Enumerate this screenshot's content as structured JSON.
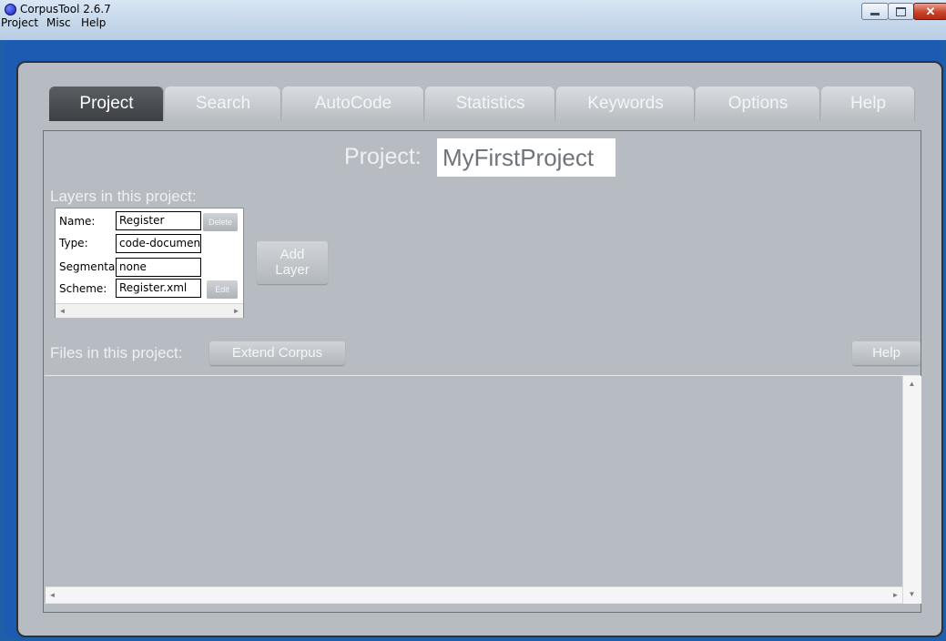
{
  "window": {
    "title": "CorpusTool 2.6.7",
    "close_glyph": "✕"
  },
  "menu": [
    "Project",
    "Misc",
    "Help"
  ],
  "tabs": [
    {
      "label": "Project",
      "active": true
    },
    {
      "label": "Search",
      "active": false
    },
    {
      "label": "AutoCode",
      "active": false
    },
    {
      "label": "Statistics",
      "active": false
    },
    {
      "label": "Keywords",
      "active": false
    },
    {
      "label": "Options",
      "active": false
    },
    {
      "label": "Help",
      "active": false
    }
  ],
  "project": {
    "label": "Project:",
    "name": "MyFirstProject"
  },
  "layers": {
    "heading": "Layers in this project:",
    "fields": {
      "name_label": "Name:",
      "name_value": "Register",
      "type_label": "Type:",
      "type_value": "code-documen",
      "segmentation_label": "Segmenta",
      "segmentation_value": "none",
      "scheme_label": "Scheme:",
      "scheme_value": "Register.xml"
    },
    "delete_label": "Delete",
    "edit_label": "Edit",
    "add_layer_line1": "Add",
    "add_layer_line2": "Layer"
  },
  "files": {
    "heading": "Files in this project:",
    "extend_label": "Extend Corpus",
    "help_label": "Help"
  },
  "scroll_glyphs": {
    "left": "◄",
    "right": "►",
    "up": "▲",
    "down": "▼"
  },
  "colors": {
    "panel": "#b7bcc2",
    "active_tab": "#4a4e52",
    "window_frame": "#1f5ea8"
  }
}
